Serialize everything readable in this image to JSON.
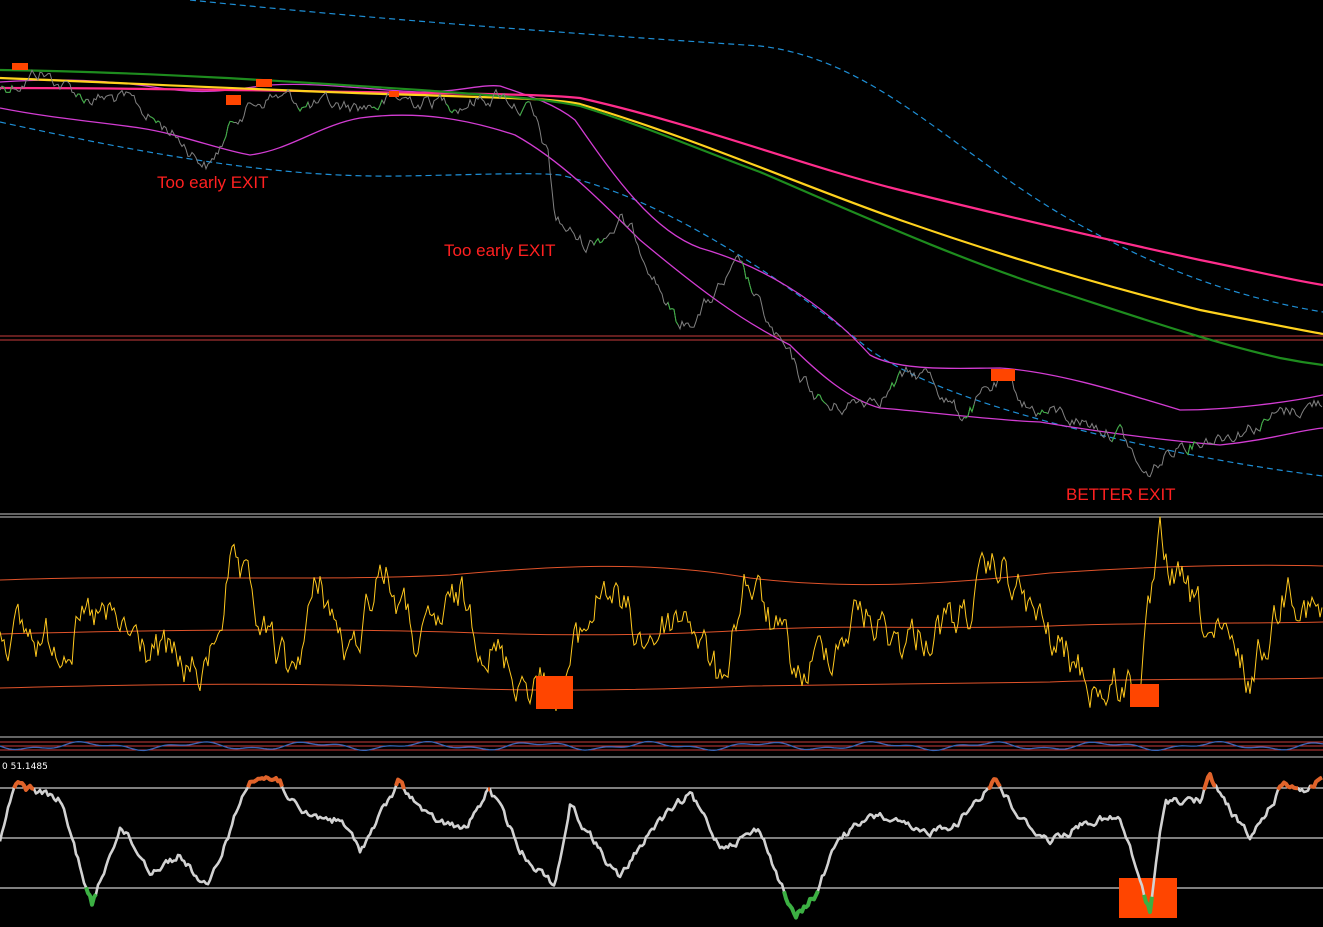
{
  "chart_data": [
    {
      "panel": "price",
      "type": "line",
      "colors": {
        "price": "#808080",
        "price_up": "#3cb043",
        "envelope": "#d23cd2",
        "dashed_band": "#1e8fd6",
        "ma_magenta": "#ff2d8c",
        "ma_yellow": "#ffd21e",
        "ma_green": "#1e8c1e",
        "marker": "#ff4500",
        "hline": "#c83c3c"
      },
      "annotations": [
        {
          "text": "Too early EXIT",
          "color": "#ff2020"
        },
        {
          "text": "Too early EXIT",
          "color": "#ff2020"
        },
        {
          "text": "BETTER EXIT",
          "color": "#ff2020"
        }
      ],
      "markers": 6
    },
    {
      "panel": "oscillator_1",
      "type": "line",
      "colors": {
        "line": "#ffc81e",
        "bands": "#e0532a",
        "highlight": "#ff4500"
      },
      "highlights": 2
    },
    {
      "panel": "oscillator_2",
      "type": "line",
      "colors": {
        "line": "#3c64b4",
        "bands": "#c83c3c"
      }
    },
    {
      "panel": "oscillator_3",
      "type": "line",
      "readout": "0 51.1485",
      "colors": {
        "line": "#d2d2d2",
        "overbought": "#e0632a",
        "oversold": "#3cb043",
        "levels": "#ffffff",
        "highlight": "#ff4500"
      },
      "highlights": 1
    }
  ]
}
